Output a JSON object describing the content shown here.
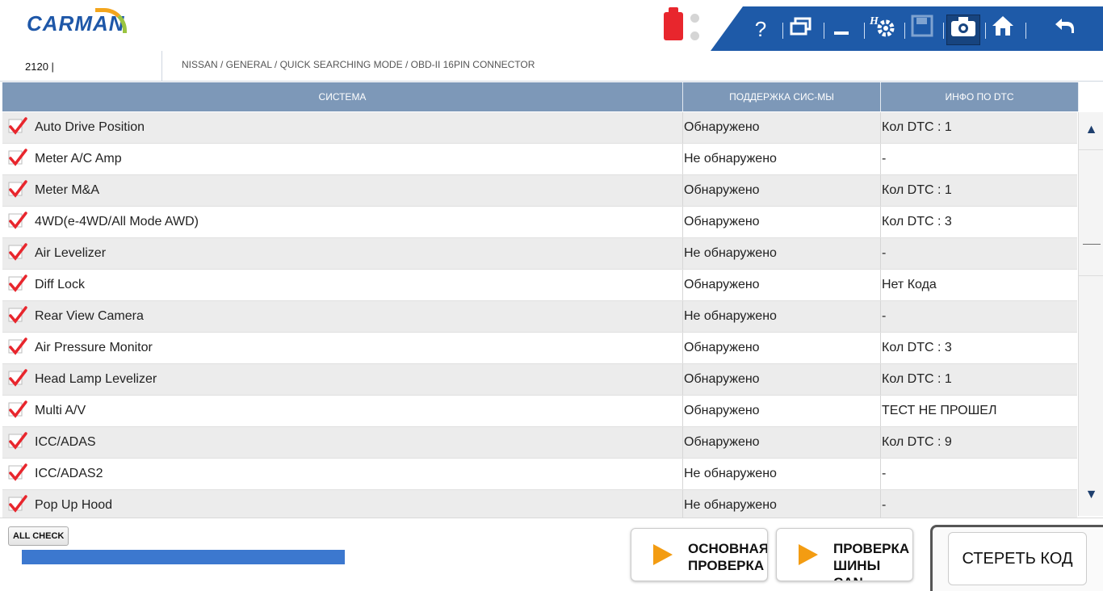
{
  "app": {
    "logo": "CARMAN"
  },
  "toolbar": {
    "icons": [
      "usb-icon",
      "help-icon",
      "windows-icon",
      "minimize-icon",
      "settings-icon",
      "save-icon",
      "camera-icon",
      "home-icon",
      "back-icon"
    ],
    "help_glyph": "?"
  },
  "crumb": {
    "vehicle_id": "2120  |",
    "path": "NISSAN / GENERAL / QUICK SEARCHING MODE / OBD-II 16PIN CONNECTOR"
  },
  "table": {
    "headers": [
      "СИСТЕМА",
      "ПОДДЕРЖКА СИС-МЫ",
      "ИНФО ПО DTC"
    ],
    "rows": [
      {
        "system": "Auto Drive Position",
        "support": "Обнаружено",
        "dtc": "Кол DTC : 1"
      },
      {
        "system": "Meter A/C Amp",
        "support": "Не обнаружено",
        "dtc": "-"
      },
      {
        "system": "Meter M&A",
        "support": "Обнаружено",
        "dtc": "Кол DTC : 1"
      },
      {
        "system": "4WD(e-4WD/All Mode AWD)",
        "support": "Обнаружено",
        "dtc": "Кол DTC : 3"
      },
      {
        "system": "Air Levelizer",
        "support": "Не обнаружено",
        "dtc": "-"
      },
      {
        "system": "Diff Lock",
        "support": "Обнаружено",
        "dtc": "Нет Кода"
      },
      {
        "system": "Rear View Camera",
        "support": "Не обнаружено",
        "dtc": "-"
      },
      {
        "system": "Air Pressure Monitor",
        "support": "Обнаружено",
        "dtc": "Кол DTC : 3"
      },
      {
        "system": "Head Lamp Levelizer",
        "support": "Обнаружено",
        "dtc": "Кол DTC : 1"
      },
      {
        "system": "Multi A/V",
        "support": "Обнаружено",
        "dtc": "ТЕСТ НЕ ПРОШЕЛ"
      },
      {
        "system": "ICC/ADAS",
        "support": "Обнаружено",
        "dtc": "Кол DTC : 9"
      },
      {
        "system": "ICC/ADAS2",
        "support": "Не обнаружено",
        "dtc": "-"
      },
      {
        "system": "Pop Up Hood",
        "support": "Не обнаружено",
        "dtc": "-"
      }
    ]
  },
  "bottom": {
    "all_check": "ALL CHECK",
    "btn_main": "ОСНОВНАЯ\nПРОВЕРКА",
    "btn_can": "ПРОВЕРКА\nШИНЫ\nCAN",
    "btn_erase": "СТЕРЕТЬ КОД"
  },
  "colors": {
    "accent": "#1e5aa8",
    "header_row": "#7d98b8",
    "check": "#e8262d",
    "progress": "#3c78cf",
    "play": "#f39c12"
  }
}
